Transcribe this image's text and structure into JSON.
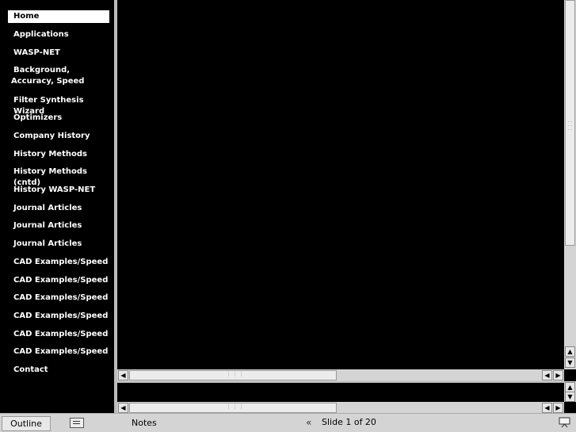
{
  "sidebar": {
    "items": [
      {
        "label": "Home",
        "selected": true
      },
      {
        "label": "Applications"
      },
      {
        "label": "WASP-NET"
      },
      {
        "label": "Background, Accuracy, Speed"
      },
      {
        "label": "Filter Synthesis Wizard"
      },
      {
        "label": "Optimizers"
      },
      {
        "label": "Company History"
      },
      {
        "label": "History Methods"
      },
      {
        "label": "History Methods (cntd)"
      },
      {
        "label": "History WASP-NET"
      },
      {
        "label": "Journal Articles"
      },
      {
        "label": "Journal Articles"
      },
      {
        "label": "Journal Articles"
      },
      {
        "label": "CAD Examples/Speed"
      },
      {
        "label": "CAD Examples/Speed"
      },
      {
        "label": "CAD Examples/Speed"
      },
      {
        "label": "CAD Examples/Speed"
      },
      {
        "label": "CAD Examples/Speed"
      },
      {
        "label": "CAD Examples/Speed"
      },
      {
        "label": "Contact"
      }
    ]
  },
  "statusbar": {
    "outline_label": "Outline",
    "notes_label": "Notes",
    "slide_counter": "Slide 1 of 20"
  },
  "icons": {
    "prev": "double-chevron-left-icon",
    "present": "presentation-icon",
    "outline": "outline-view-icon"
  }
}
